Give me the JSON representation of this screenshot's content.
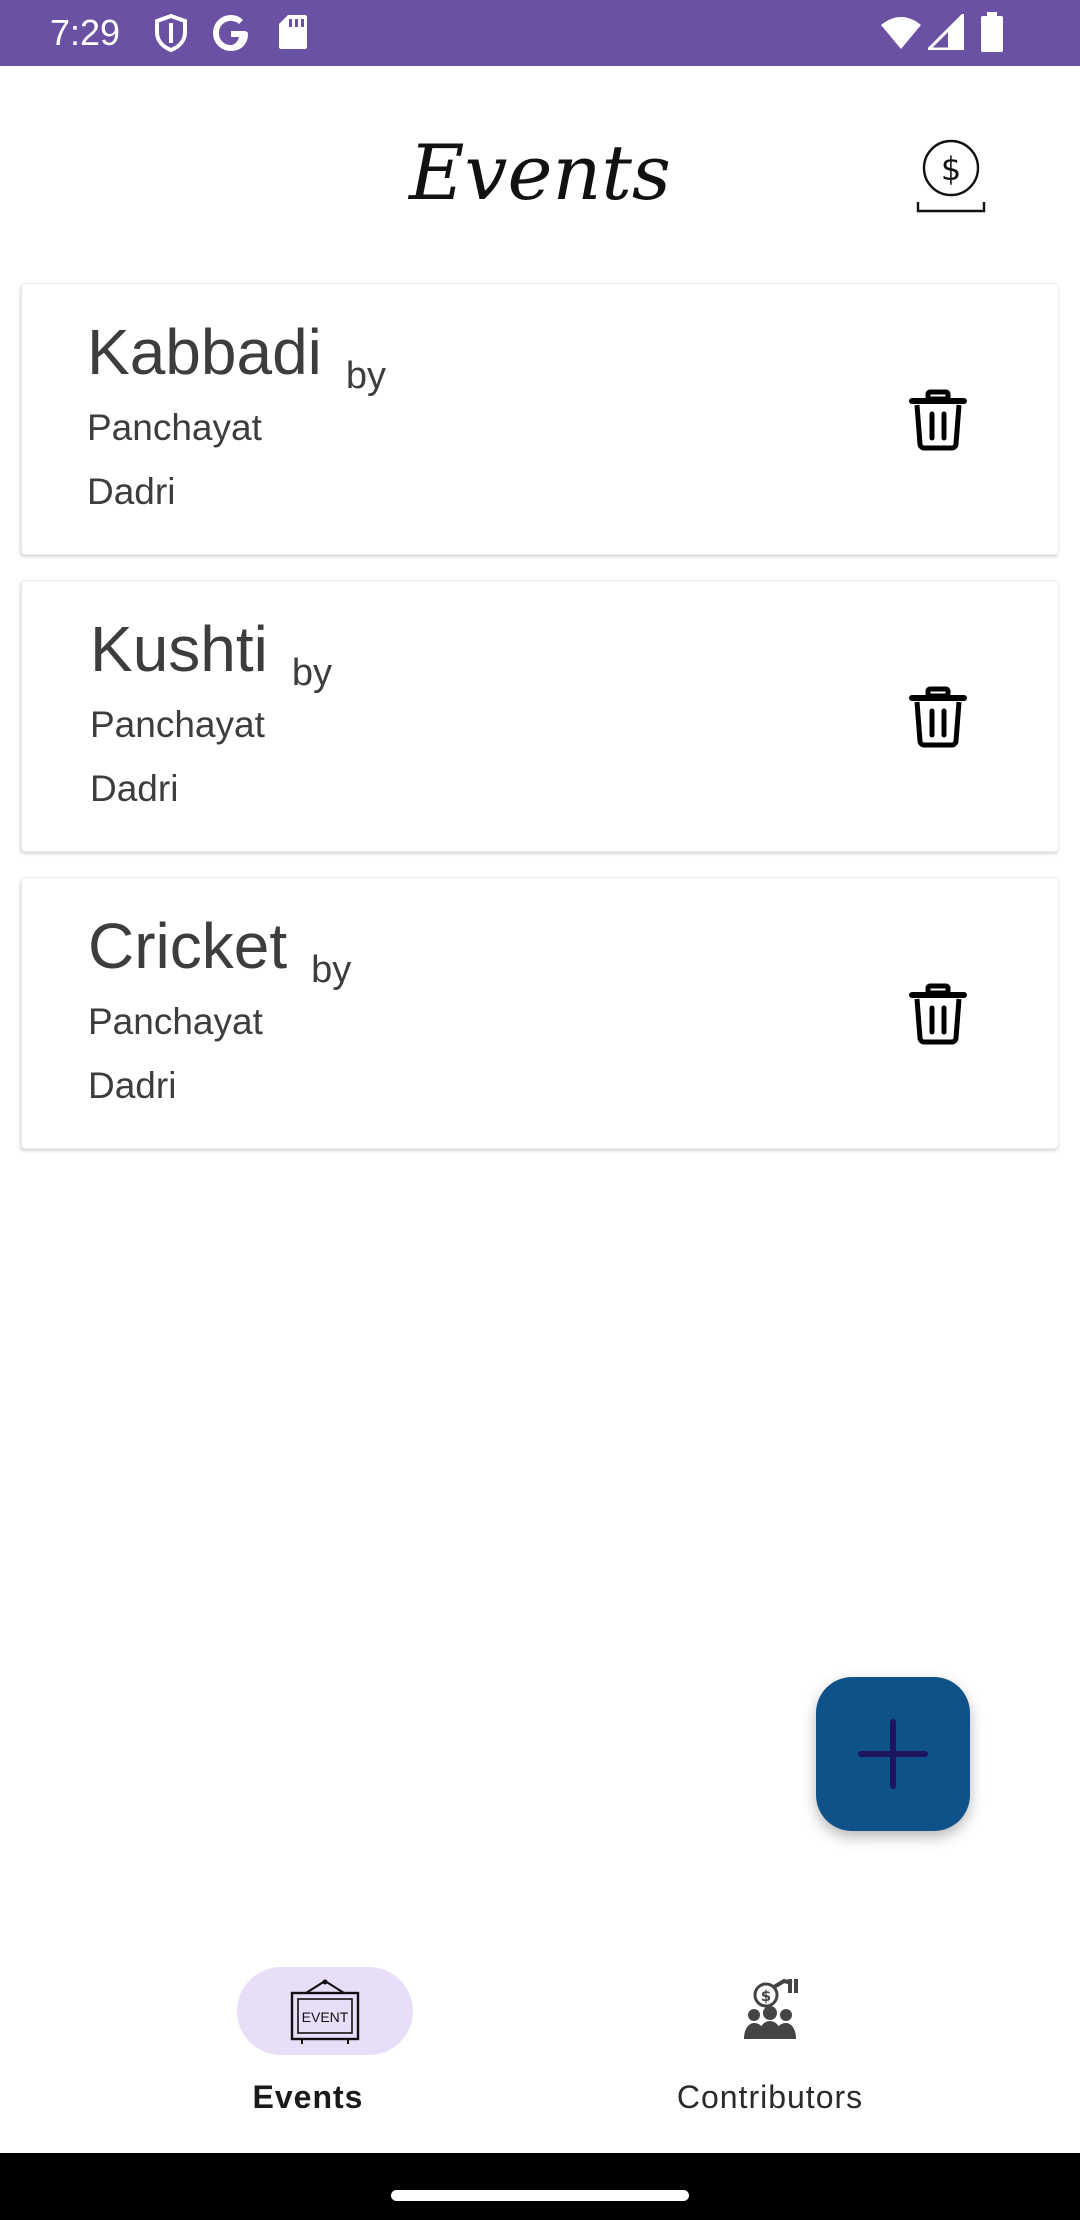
{
  "status_bar": {
    "time": "7:29",
    "background_color": "#6a51a3",
    "left_icons": [
      "shield-icon",
      "google-g-icon",
      "sd-card-icon"
    ],
    "right_icons": [
      "wifi-icon",
      "cellular-signal-icon",
      "battery-icon"
    ]
  },
  "header": {
    "title": "Events",
    "action_icon": "money-bag-icon"
  },
  "events": [
    {
      "name": "Kabbadi",
      "by_label": "by",
      "organizer_line1": "Panchayat",
      "organizer_line2": "Dadri",
      "action_icon": "trash-icon"
    },
    {
      "name": "Kushti",
      "by_label": "by",
      "organizer_line1": "Panchayat",
      "organizer_line2": "Dadri",
      "action_icon": "trash-icon"
    },
    {
      "name": "Cricket",
      "by_label": "by",
      "organizer_line1": "Panchayat",
      "organizer_line2": "Dadri",
      "action_icon": "trash-icon"
    }
  ],
  "fab": {
    "icon": "plus-icon",
    "color": "#0f528a"
  },
  "bottom_nav": {
    "items": [
      {
        "label": "Events",
        "icon": "event-sign-icon",
        "icon_text": "EVENT",
        "selected": true
      },
      {
        "label": "Contributors",
        "icon": "contributors-icon",
        "selected": false
      }
    ],
    "selected_pill_color": "#e8def8"
  }
}
